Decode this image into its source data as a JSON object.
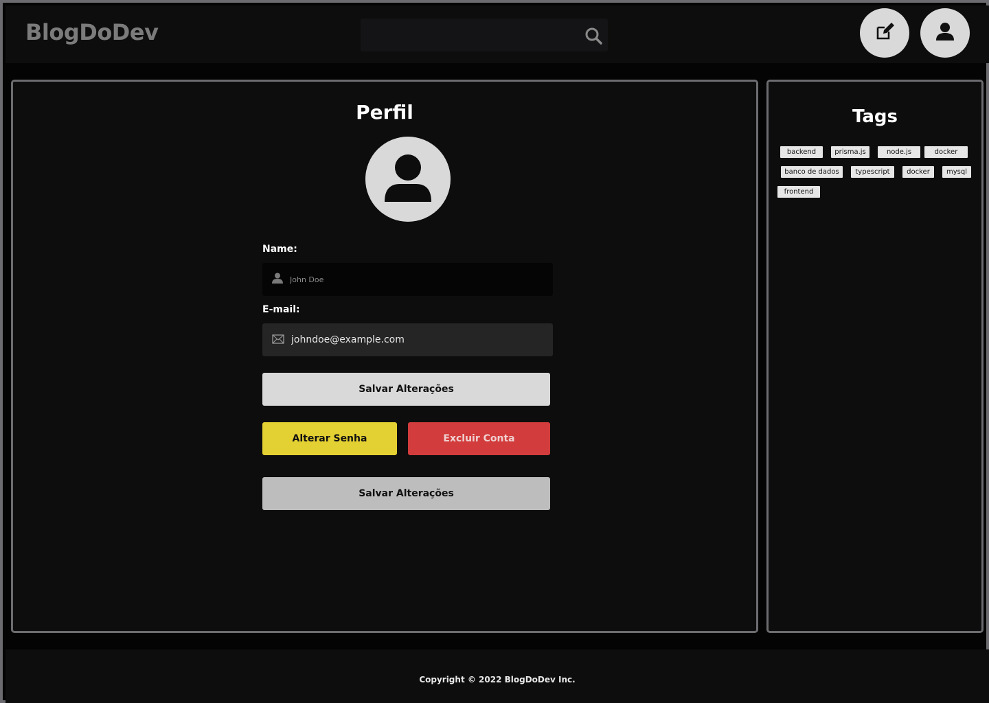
{
  "header": {
    "logo": "BlogDoDev",
    "search_placeholder": "",
    "icons": {
      "search": "search-icon",
      "edit": "edit-icon",
      "user": "user-icon"
    }
  },
  "profile": {
    "title": "Perfil",
    "avatar_icon": "user-icon",
    "name_label": "Name:",
    "name_placeholder": "John Doe",
    "email_label": "E-mail:",
    "email_value": "johndoe@example.com",
    "save_label": "Salvar Alterações",
    "change_password_label": "Alterar Senha",
    "delete_account_label": "Excluir Conta",
    "save_label_2": "Salvar Alterações"
  },
  "tags": {
    "title": "Tags",
    "items": [
      "backend",
      "prisma.js",
      "node.js",
      "docker",
      "banco de dados",
      "typescript",
      "docker",
      "mysql",
      "frontend"
    ]
  },
  "footer": {
    "copyright": "Copyright © 2022 BlogDoDev Inc."
  },
  "colors": {
    "background": "#040404",
    "panel": "#0d0d0d",
    "border": "#6c6c70",
    "light_button": "#d9d9d9",
    "yellow_button": "#e3d032",
    "red_button": "#d23c3c"
  }
}
